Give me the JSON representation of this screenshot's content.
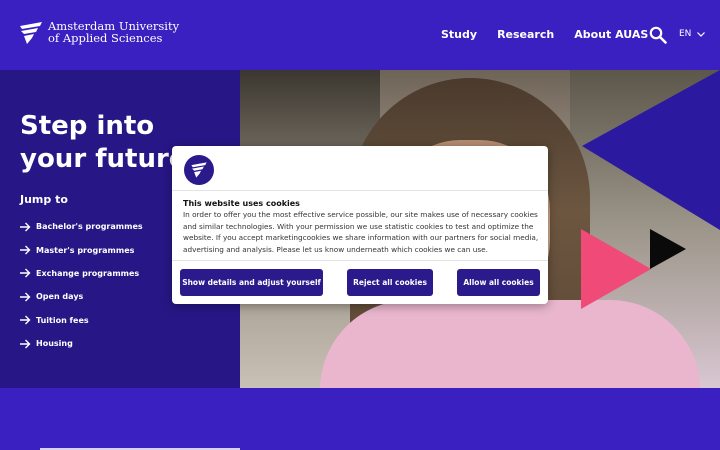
{
  "header": {
    "logo_line1": "Amsterdam University",
    "logo_line2": "of Applied Sciences",
    "nav": [
      "Study",
      "Research",
      "About AUAS"
    ],
    "search_icon": "search-icon",
    "language": "EN"
  },
  "hero": {
    "title_line1": "Step into",
    "title_line2": "your future",
    "jump_title": "Jump to",
    "links": [
      "Bachelor's programmes",
      "Master's programmes",
      "Exchange programmes",
      "Open days",
      "Tuition fees",
      "Housing"
    ]
  },
  "cookie": {
    "title": "This website uses cookies",
    "text": "In order to offer you the most effective service possible, our site makes use of necessary cookies and similar technologies. With your permission we use statistic cookies to test and optimize the website. If you accept marketingcookies we share information with our partners for social media, advertising and analysis. Please let us know underneath which cookies we can use.",
    "btn_details": "Show details and adjust yourself",
    "btn_reject": "Reject all cookies",
    "btn_allow": "Allow all cookies"
  },
  "colors": {
    "brand_blue": "#3a1fc1",
    "dark_purple": "#271685",
    "button": "#2b1a8c",
    "accent_pink": "#f04a78"
  }
}
